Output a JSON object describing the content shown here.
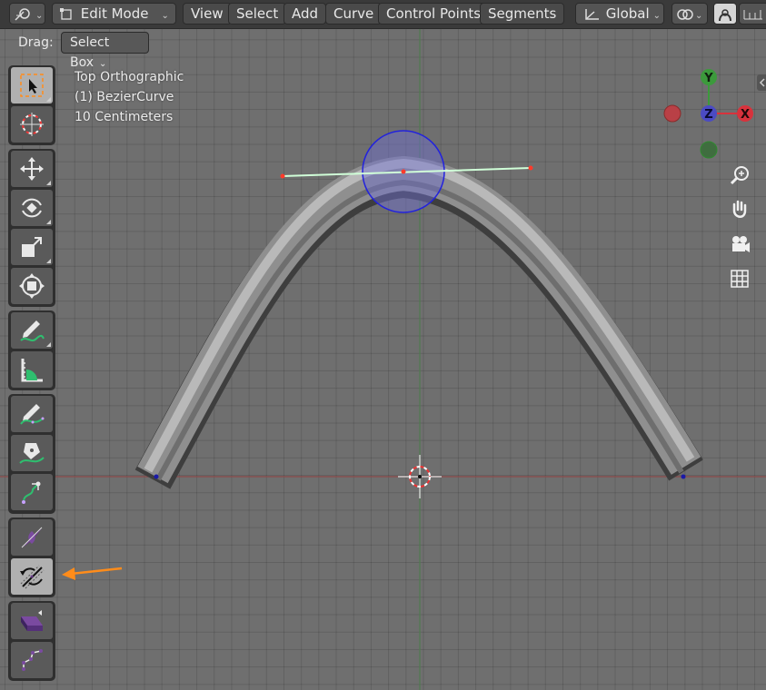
{
  "header": {
    "mode": "Edit Mode",
    "menus": [
      "View",
      "Select",
      "Add",
      "Curve",
      "Control Points",
      "Segments"
    ],
    "orientation": "Global"
  },
  "tool_settings": {
    "drag_label": "Drag:",
    "drag_value": "Select Box"
  },
  "viewport": {
    "view_name": "Top Orthographic",
    "object_name": "(1) BezierCurve",
    "scale": "10 Centimeters"
  },
  "gizmo": {
    "y_label": "Y",
    "z_label": "Z",
    "x_label": "X",
    "colors": {
      "x": "#d8323c",
      "y": "#3c9a3c",
      "z": "#4b4bc3"
    }
  },
  "toolbar_tools": [
    "select-box",
    "cursor",
    "move",
    "rotate",
    "scale",
    "transform",
    "annotate",
    "measure",
    "draw",
    "pen",
    "extrude",
    "radius",
    "tilt",
    "randomize",
    "shear"
  ],
  "colors": {
    "accent_arrow": "#ff8c1a",
    "handle_line": "#c8ffd0",
    "proportional_circle": "#2020d8"
  }
}
